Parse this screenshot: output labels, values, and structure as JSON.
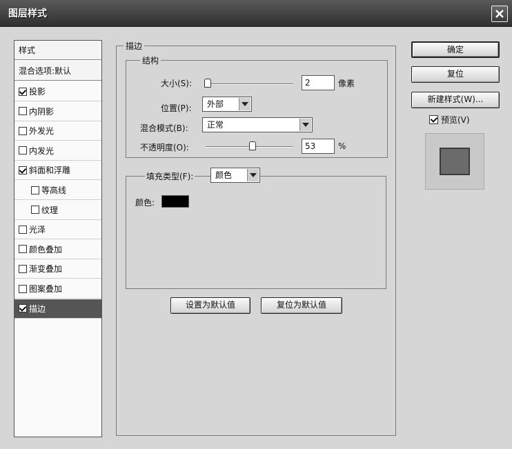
{
  "window": {
    "title": "图层样式"
  },
  "styles_panel": {
    "header": "样式",
    "blend_options": "混合选项:默认",
    "items": [
      {
        "label": "投影",
        "checked": true,
        "sub": false,
        "selected": false
      },
      {
        "label": "内阴影",
        "checked": false,
        "sub": false,
        "selected": false
      },
      {
        "label": "外发光",
        "checked": false,
        "sub": false,
        "selected": false
      },
      {
        "label": "内发光",
        "checked": false,
        "sub": false,
        "selected": false
      },
      {
        "label": "斜面和浮雕",
        "checked": true,
        "sub": false,
        "selected": false
      },
      {
        "label": "等高线",
        "checked": false,
        "sub": true,
        "selected": false
      },
      {
        "label": "纹理",
        "checked": false,
        "sub": true,
        "selected": false
      },
      {
        "label": "光泽",
        "checked": false,
        "sub": false,
        "selected": false
      },
      {
        "label": "颜色叠加",
        "checked": false,
        "sub": false,
        "selected": false
      },
      {
        "label": "渐变叠加",
        "checked": false,
        "sub": false,
        "selected": false
      },
      {
        "label": "图案叠加",
        "checked": false,
        "sub": false,
        "selected": false
      },
      {
        "label": "描边",
        "checked": true,
        "sub": false,
        "selected": true
      }
    ]
  },
  "stroke": {
    "title": "描边",
    "structure_title": "结构",
    "size_label": "大小(S):",
    "size_value": "2",
    "size_unit": "像素",
    "size_fraction": 0.02,
    "position_label": "位置(P):",
    "position_value": "外部",
    "blend_label": "混合模式(B):",
    "blend_value": "正常",
    "opacity_label": "不透明度(O):",
    "opacity_value": "53",
    "opacity_unit": "%",
    "opacity_fraction": 0.53,
    "fill_type_label": "填充类型(F):",
    "fill_type_value": "颜色",
    "color_label": "颜色:",
    "color_value": "#000000"
  },
  "buttons": {
    "set_default": "设置为默认值",
    "reset_default": "复位为默认值",
    "ok": "确定",
    "reset": "复位",
    "new_style": "新建样式(W)...",
    "preview_label": "预览(V)",
    "preview_checked": true
  }
}
